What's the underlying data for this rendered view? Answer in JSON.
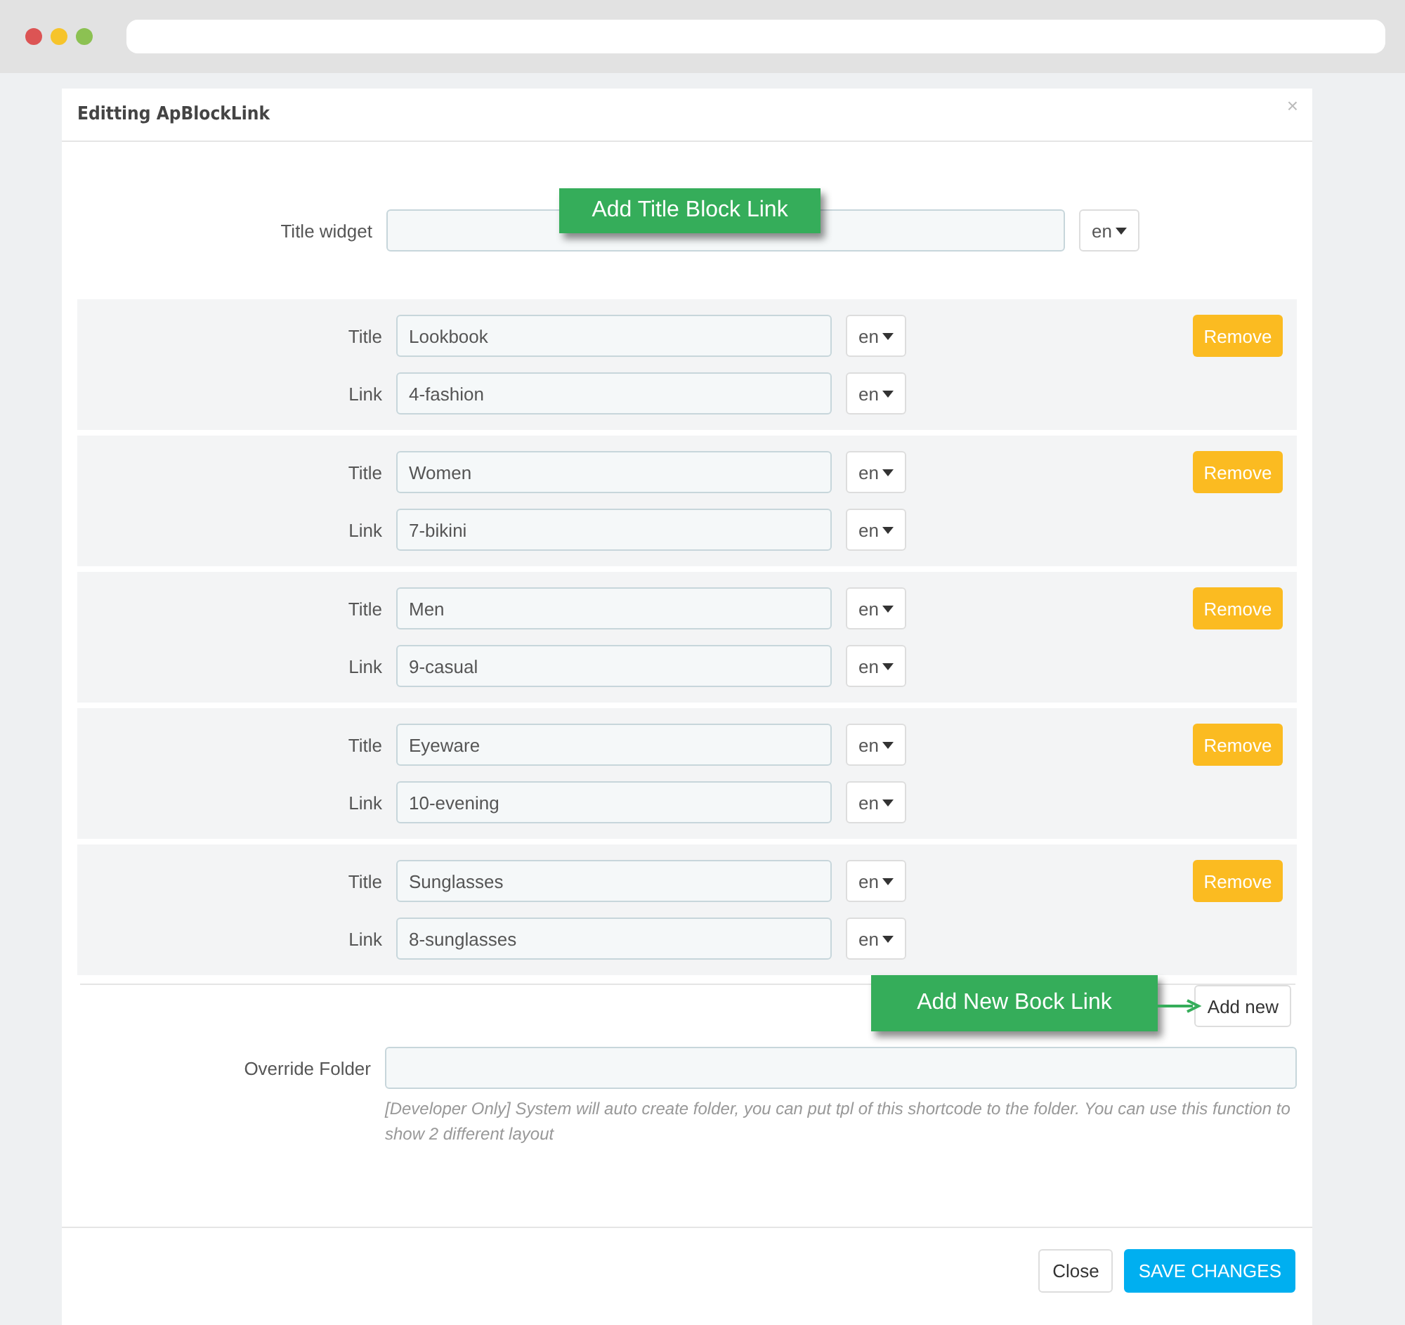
{
  "dialog": {
    "title": "Editting ApBlockLink",
    "close": "×"
  },
  "title_widget": {
    "label": "Title widget",
    "lang": "en"
  },
  "callouts": [
    {
      "text": "Add Title Block Link"
    },
    {
      "text": "Add New Bock Link"
    }
  ],
  "links": [
    {
      "title_label": "Title",
      "title": "Lookbook",
      "title_lang": "en",
      "link_label": "Link",
      "link": "4-fashion",
      "link_lang": "en",
      "remove": "Remove"
    },
    {
      "title_label": "Title",
      "title": "Women",
      "title_lang": "en",
      "link_label": "Link",
      "link": "7-bikini",
      "link_lang": "en",
      "remove": "Remove"
    },
    {
      "title_label": "Title",
      "title": "Men",
      "title_lang": "en",
      "link_label": "Link",
      "link": "9-casual",
      "link_lang": "en",
      "remove": "Remove"
    },
    {
      "title_label": "Title",
      "title": "Eyeware",
      "title_lang": "en",
      "link_label": "Link",
      "link": "10-evening",
      "link_lang": "en",
      "remove": "Remove"
    },
    {
      "title_label": "Title",
      "title": "Sunglasses",
      "title_lang": "en",
      "link_label": "Link",
      "link": "8-sunglasses",
      "link_lang": "en",
      "remove": "Remove"
    }
  ],
  "add_button": "Add new",
  "override_folder": {
    "label": "Override Folder",
    "help": "[Developer Only] System will auto create folder, you can put tpl of this shortcode to the folder. You can use this function to show 2 different layout"
  },
  "footer": {
    "buttons": [
      {
        "label": "Close",
        "kind": "default"
      },
      {
        "label": "SAVE CHANGES",
        "kind": "primary"
      }
    ]
  }
}
